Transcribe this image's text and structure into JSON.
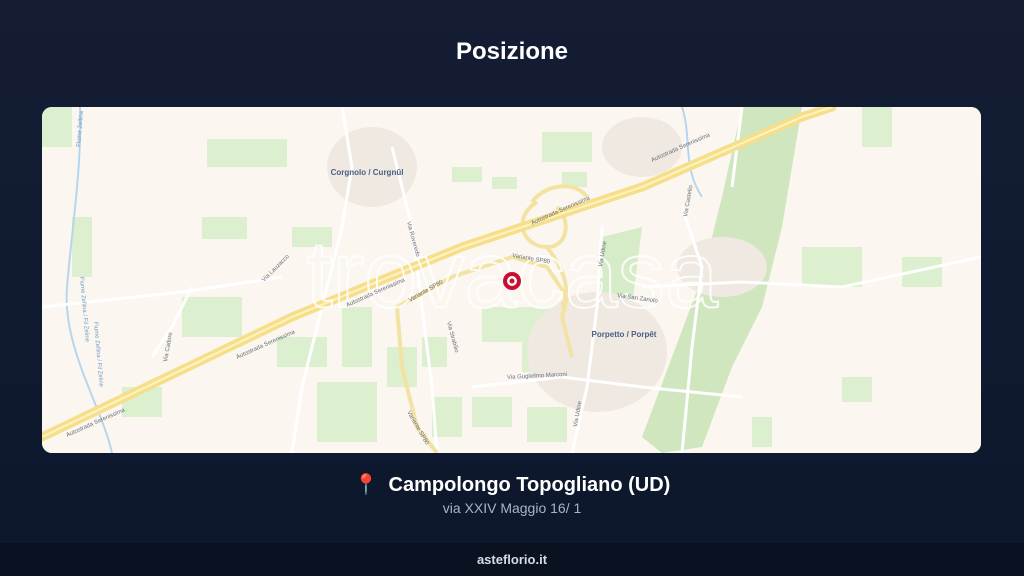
{
  "page": {
    "title": "Posizione"
  },
  "map": {
    "watermark": "trovacasa",
    "place_labels": {
      "corgnolo": "Corgnolo / Curgnûl",
      "porpetto": "Porpetto / Porpêt"
    },
    "road_labels": {
      "autostrada_1": "Autostrada Serenissima",
      "autostrada_2": "Autostrada Serenissima",
      "autostrada_3": "Autostrada Serenissima",
      "autostrada_4": "Autostrada Serenissima",
      "autostrada_5": "Autostrada Serenissima",
      "variante_a": "Variante SP80",
      "variante_b": "Variante SP80",
      "variante_c": "Variante SP80",
      "via_udine_a": "Via Udine",
      "via_udine_b": "Via Udine",
      "via_castello": "Via Castello",
      "via_zanolo": "Via San Zanolo",
      "via_marconi": "Via Guglielmo Marconi",
      "via_roveredo": "Via Roveredo",
      "via_strabilio": "Via Strabilio",
      "via_lauzacco": "Via Lauzacco",
      "via_cadore": "Via Cadore",
      "fiume_a": "Fiume Zellina / Fil Zeline",
      "fiume_b": "Fiume Zellina / Fil Zeline",
      "fiume_c": "Fiume Zellina"
    },
    "marker_icon": "map-marker-icon"
  },
  "location": {
    "pin_icon": "📍",
    "name": "Campolongo Topogliano (UD)",
    "address": "via XXIV Maggio 16/ 1"
  },
  "footer": {
    "brand": "asteflorio.it"
  },
  "colors": {
    "background": "#111a2f",
    "map_base": "#fbf7f0",
    "motorway": "#f5df8a",
    "green": "#dcefcf",
    "marker": "#c8102e"
  }
}
